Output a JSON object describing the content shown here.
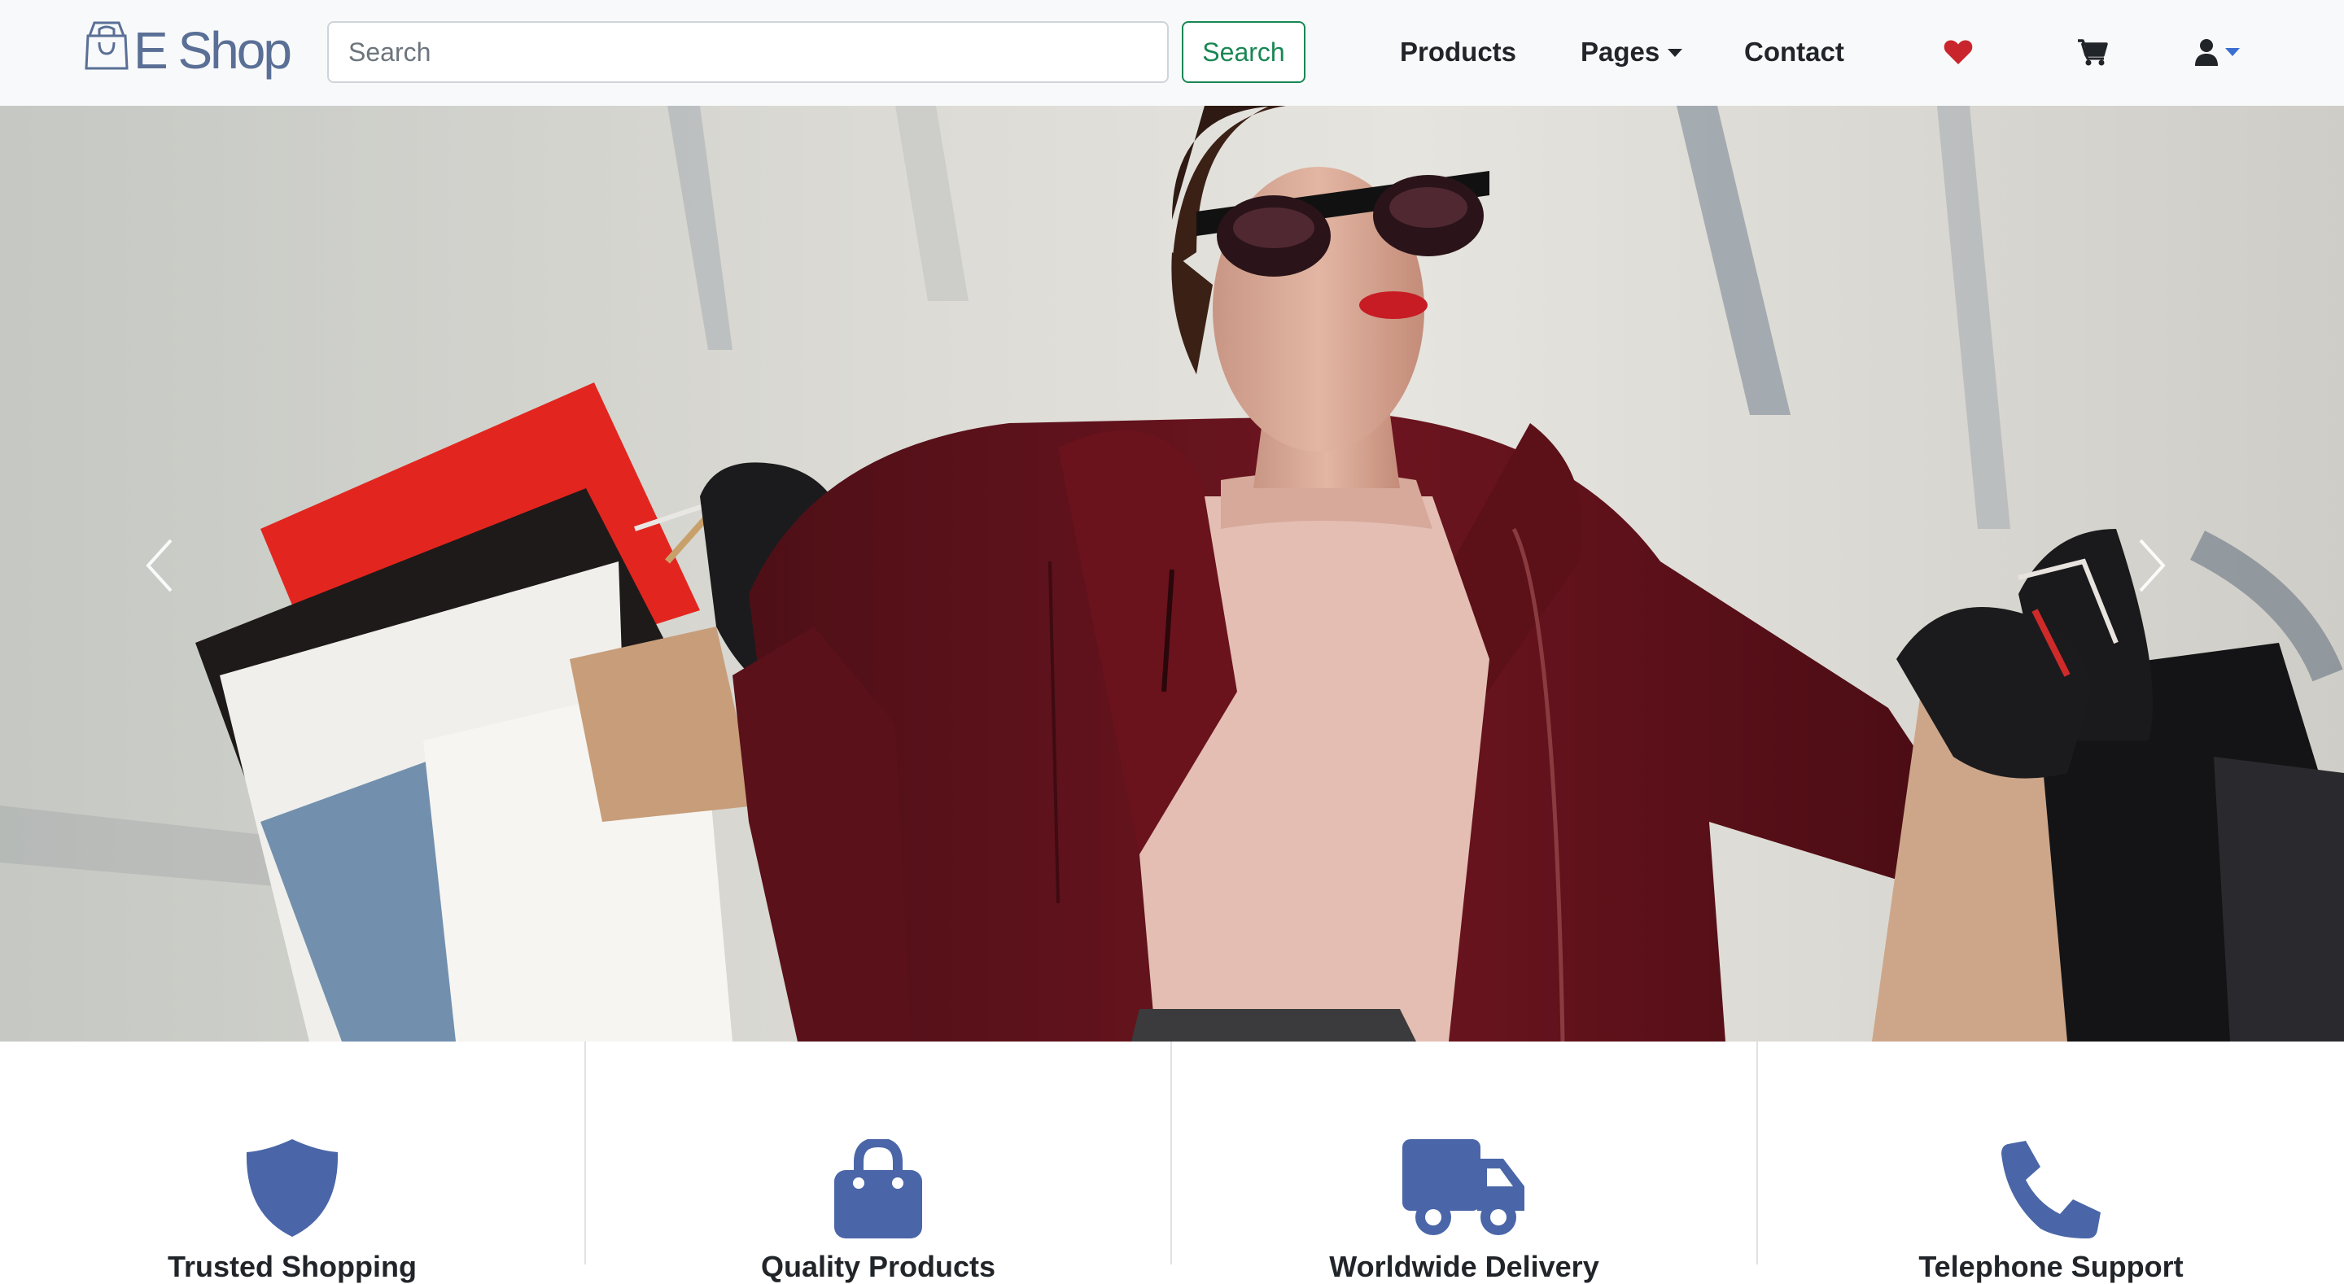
{
  "brand": {
    "name": "E Shop",
    "icon": "shopping-bag-logo-icon"
  },
  "search": {
    "placeholder": "Search",
    "value": "",
    "button_label": "Search"
  },
  "nav": {
    "products": "Products",
    "pages": "Pages",
    "contact": "Contact",
    "icons": [
      "heart-icon",
      "cart-icon",
      "user-icon"
    ]
  },
  "hero": {
    "image": "woman-with-shopping-bags",
    "controls": {
      "prev": "chevron-left-icon",
      "next": "chevron-right-icon"
    }
  },
  "features": [
    {
      "icon": "shield-icon",
      "title": "Trusted Shopping"
    },
    {
      "icon": "shopping-bag-icon",
      "title": "Quality Products"
    },
    {
      "icon": "truck-icon",
      "title": "Worldwide Delivery"
    },
    {
      "icon": "phone-icon",
      "title": "Telephone Support"
    }
  ],
  "colors": {
    "navbar_bg": "#f8f9fa",
    "success": "#198754",
    "feature_icon": "#4a66a8",
    "heart": "#c9252c",
    "user_caret": "#3b6fd1"
  }
}
